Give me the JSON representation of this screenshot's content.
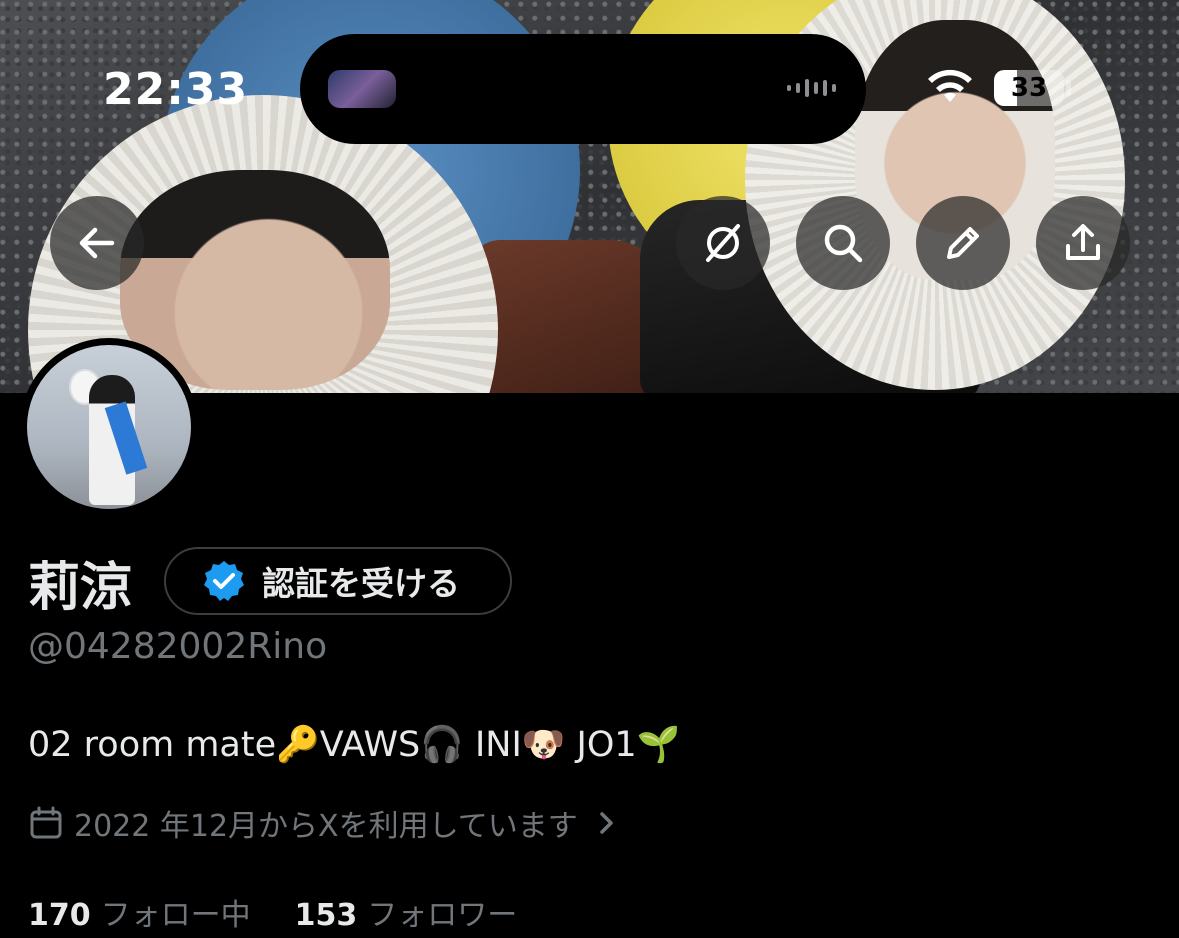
{
  "status_bar": {
    "time": "22:33",
    "battery_percent": "33",
    "battery_level": 0.33
  },
  "header": {
    "buttons": [
      {
        "name": "back",
        "icon": "back-arrow-icon"
      },
      {
        "name": "grok",
        "icon": "grok-slash-circle-icon"
      },
      {
        "name": "search",
        "icon": "search-icon"
      },
      {
        "name": "edit",
        "icon": "pencil-icon"
      },
      {
        "name": "share",
        "icon": "share-icon"
      }
    ]
  },
  "profile": {
    "display_name": "莉涼",
    "verify_button_label": "認証を受ける",
    "handle": "@04282002Rino",
    "bio": "02 room mate🔑VAWS🎧 INI🐶 JO1🌱",
    "joined": "2022 年12月からXを利用しています",
    "following_count": "170",
    "following_label": "フォロー中",
    "followers_count": "153",
    "followers_label": "フォロワー"
  },
  "colors": {
    "background": "#000000",
    "text_primary": "#e7e9ea",
    "text_secondary": "#71767b",
    "verified_blue": "#1d9bf0"
  }
}
